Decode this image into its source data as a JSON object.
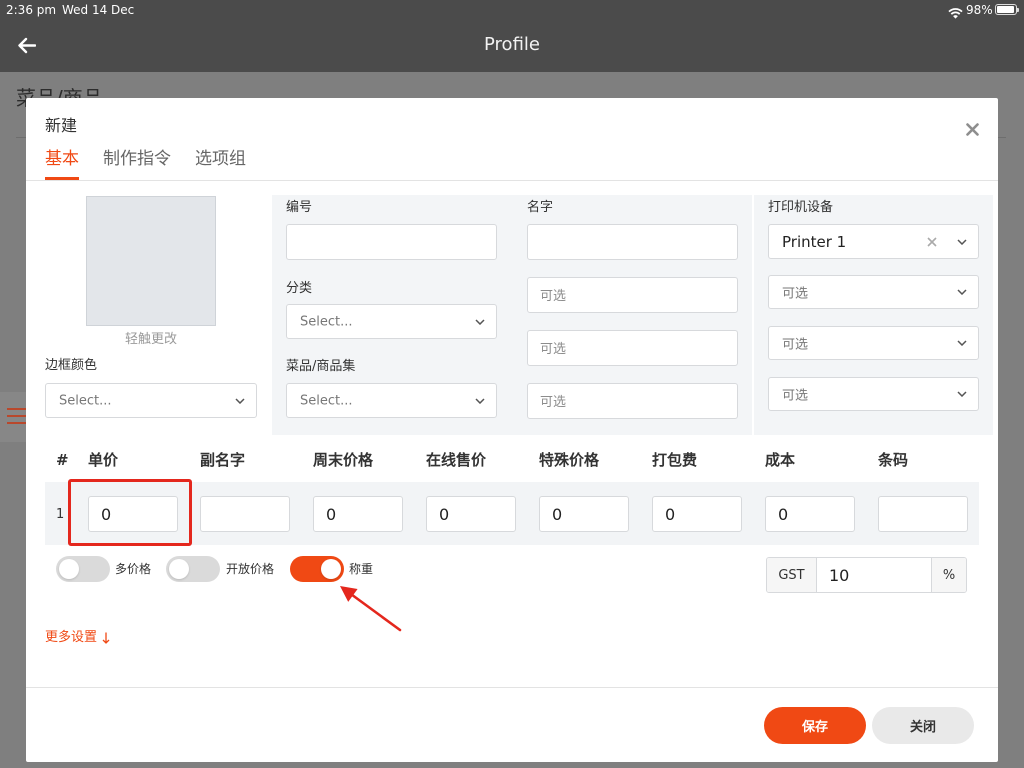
{
  "status_bar": {
    "time": "2:36 pm",
    "date": "Wed 14 Dec",
    "battery": "98%",
    "icons": [
      "wifi-icon",
      "battery-icon"
    ]
  },
  "nav": {
    "title": "Profile",
    "back_icon": "arrow-left-icon"
  },
  "background_page": {
    "title": "菜品/商品",
    "menu_icon": "hamburger-icon"
  },
  "modal": {
    "title": "新建",
    "close_icon": "close-icon",
    "tabs": [
      {
        "label": "基本",
        "active": true
      },
      {
        "label": "制作指令",
        "active": false
      },
      {
        "label": "选项组",
        "active": false
      }
    ],
    "image": {
      "hint": "轻触更改"
    },
    "border_color": {
      "label": "边框颜色",
      "placeholder": "Select..."
    },
    "code": {
      "label": "编号",
      "value": ""
    },
    "category": {
      "label": "分类",
      "placeholder": "Select..."
    },
    "collection": {
      "label": "菜品/商品集",
      "placeholder": "Select..."
    },
    "name": {
      "label": "名字",
      "value": "",
      "optional_fields": [
        {
          "placeholder": "可选"
        },
        {
          "placeholder": "可选"
        },
        {
          "placeholder": "可选"
        }
      ]
    },
    "printer": {
      "label": "打印机设备",
      "selected": "Printer 1",
      "optional_selects": [
        {
          "placeholder": "可选"
        },
        {
          "placeholder": "可选"
        },
        {
          "placeholder": "可选"
        }
      ]
    },
    "price_table": {
      "headers": [
        "#",
        "单价",
        "副名字",
        "周末价格",
        "在线售价",
        "特殊价格",
        "打包费",
        "成本",
        "条码"
      ],
      "rows": [
        {
          "index": "1",
          "values": [
            "0",
            "",
            "0",
            "0",
            "0",
            "0",
            "0",
            ""
          ]
        }
      ]
    },
    "toggles": [
      {
        "label": "多价格",
        "on": false
      },
      {
        "label": "开放价格",
        "on": false
      },
      {
        "label": "称重",
        "on": true
      }
    ],
    "tax": {
      "label": "GST",
      "value": "10",
      "unit": "%"
    },
    "more_settings": "更多设置",
    "buttons": {
      "save": "保存",
      "close": "关闭"
    }
  },
  "colors": {
    "accent": "#f04914",
    "annotation": "#e4271d",
    "header_bg": "#4b4b4b",
    "overlay": "#7f7f7f"
  }
}
